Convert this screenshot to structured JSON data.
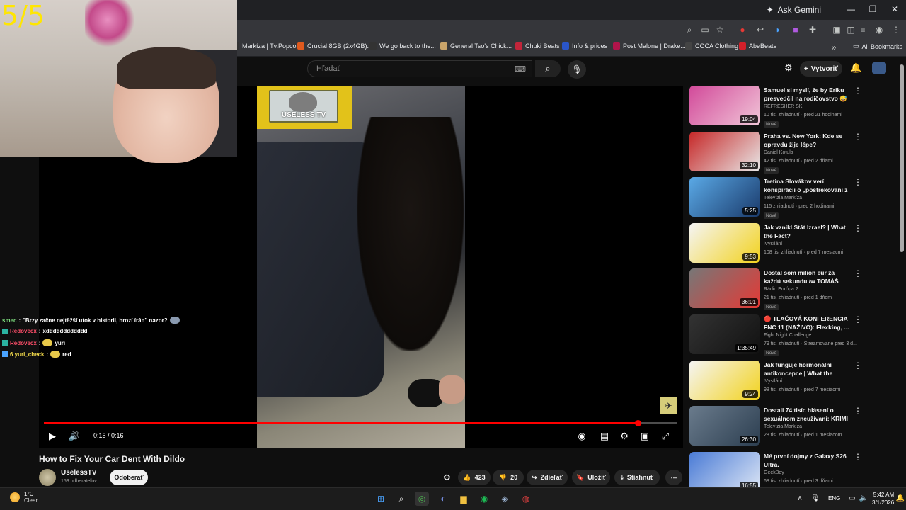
{
  "browser": {
    "ask_gemini": "Ask Gemini",
    "bookmarks": [
      {
        "label": "Markíza | Tv.Popcor...",
        "color": "#333333"
      },
      {
        "label": "Crucial 8GB (2x4GB)...",
        "color": "#e05a1e"
      },
      {
        "label": "We go back to the...",
        "color": "#333333"
      },
      {
        "label": "General Tso's Chick...",
        "color": "#c9a46a"
      },
      {
        "label": "Chuki Beats",
        "color": "#c2253a"
      },
      {
        "label": "Info & prices",
        "color": "#2a55c8"
      },
      {
        "label": "Post Malone | Drake...",
        "color": "#b0144a"
      },
      {
        "label": "COCA Clothing",
        "color": "#444444"
      },
      {
        "label": "AbeBeats",
        "color": "#d4202a"
      }
    ],
    "all_bookmarks": "All Bookmarks"
  },
  "youtube": {
    "search_placeholder": "Hľadať",
    "create_label": "Vytvoriť"
  },
  "webcam": {
    "counter": "5/5"
  },
  "player": {
    "watermark_text": "USELESS TV",
    "time": "0:15 / 0:16",
    "progress_fraction": 0.9375
  },
  "chat": [
    {
      "user": "smec",
      "user_color": "#7fe07f",
      "message": "\"Brzy začne nejtěžší utok v historii, hrozí írán\" nazor?",
      "emote": true
    },
    {
      "user": "Redovecx",
      "user_color": "#ff4f6a",
      "message": "xdddddddddddd",
      "emote": false
    },
    {
      "user": "Redovecx",
      "user_color": "#ff4f6a",
      "message": "yuri",
      "emote": true
    },
    {
      "user": "6 yuri_check",
      "user_color": "#f0d84a",
      "message": "red",
      "emote": true
    }
  ],
  "video": {
    "title": "How to Fix Your Car Dent With Dildo",
    "channel": "UselessTV",
    "subscribers": "153 odberateľov",
    "subscribe_label": "Odoberať",
    "likes": "423",
    "dislikes": "20",
    "share_label": "Zdieľať",
    "save_label": "Uložiť",
    "download_label": "Stiahnuť"
  },
  "recommendations": [
    {
      "title": "Samuel si myslí, že by Eriku presvedčil na rodičovstvo 😅 ...",
      "channel": "REFRESHER SK",
      "meta": "10 tis. zhliadnutí · pred 21 hodinami",
      "badge": "Nové",
      "duration": "19:04",
      "thumb_colors": [
        "#d24a9a",
        "#f1c6d8"
      ]
    },
    {
      "title": "Praha vs. New York: Kde se opravdu žije lépe?",
      "channel": "Daniel Kotula",
      "meta": "42 tis. zhliadnutí · pred 2 dňami",
      "badge": "Nové",
      "duration": "32:10",
      "thumb_colors": [
        "#c62828",
        "#e8e8e8"
      ]
    },
    {
      "title": "Tretina Slovákov verí konšpiráciı o „postrekovaní z ...",
      "channel": "Televízia Markíza",
      "meta": "115 zhliadnutí · pred 2 hodinami",
      "badge": "Nové",
      "duration": "5:25",
      "thumb_colors": [
        "#5aa9e6",
        "#1a3a6b"
      ]
    },
    {
      "title": "Jak vznikl Stát Izrael? | What the Fact?",
      "channel": "iVysílání",
      "meta": "108 tis. zhliadnutí · pred 7 mesiacmi",
      "badge": "",
      "duration": "9:53",
      "thumb_colors": [
        "#f5f5f5",
        "#f2d21c"
      ]
    },
    {
      "title": "Dostal som milión eur za každú sekundu /w TOMÁŠ KRIŽAN | ...",
      "channel": "Rádio Európa 2",
      "meta": "21 tis. zhliadnutí · pred 1 dňom",
      "badge": "Nové",
      "duration": "36:01",
      "thumb_colors": [
        "#777777",
        "#e53935"
      ]
    },
    {
      "title": "🔴 TLAČOVÁ KONFERENCIA FNC 11 (NAŽIVO): Flexking, ...",
      "channel": "Fight Night Challenge",
      "meta": "79 tis. zhliadnutí · Streamované pred 3 d...",
      "badge": "Nové",
      "duration": "1:35:49",
      "thumb_colors": [
        "#333333",
        "#111111"
      ]
    },
    {
      "title": "Jak funguje hormonální antikoncepce | What the Fact?",
      "channel": "iVysílání",
      "meta": "98 tis. zhliadnutí · pred 7 mesiacmi",
      "badge": "",
      "duration": "9:24",
      "thumb_colors": [
        "#f5f5f5",
        "#f2d21c"
      ]
    },
    {
      "title": "Dostali 74 tisíc hlásení o sexuálnom zneužívaní: KRIMI ...",
      "channel": "Televízia Markíza",
      "meta": "28 tis. zhliadnutí · pred 1 mesiacom",
      "badge": "",
      "duration": "26:30",
      "thumb_colors": [
        "#6a7b8c",
        "#2c3e50"
      ]
    },
    {
      "title": "Mé první dojmy z Galaxy S26 Ultra.",
      "channel": "GeekBoy",
      "meta": "68 tis. zhliadnutí · pred 3 dňami",
      "badge": "Nové",
      "duration": "16:55",
      "thumb_colors": [
        "#4a7bd6",
        "#dde6f5"
      ]
    }
  ],
  "taskbar": {
    "temperature": "1°C",
    "condition": "Clear",
    "language": "ENG",
    "time": "5:42 AM",
    "date": "3/1/2026"
  }
}
